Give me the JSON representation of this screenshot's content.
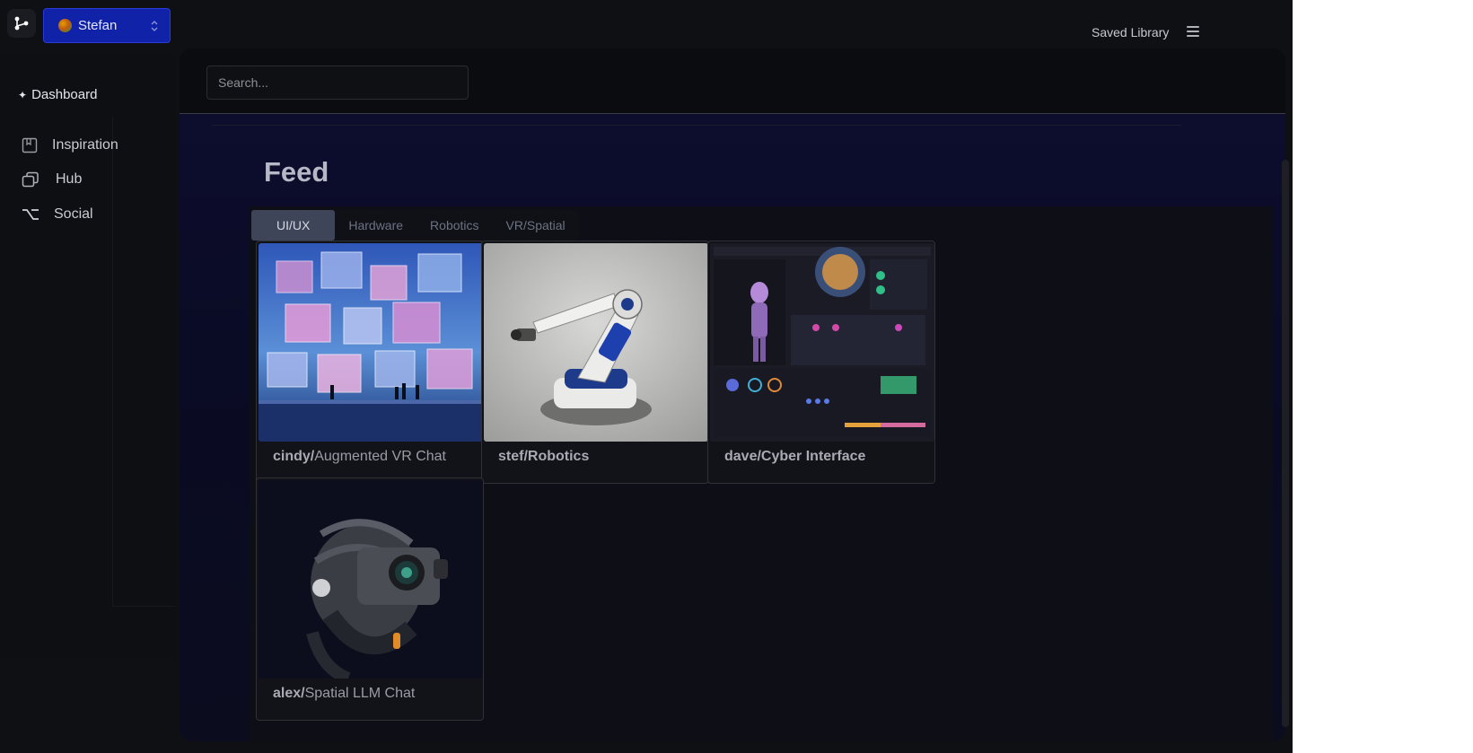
{
  "header": {
    "user_name": "Stefan",
    "saved_library_label": "Saved Library"
  },
  "sidebar": {
    "dashboard_label": "Dashboard",
    "items": [
      {
        "label": "Inspiration",
        "icon": "bookmark-icon"
      },
      {
        "label": "Hub",
        "icon": "stack-icon"
      },
      {
        "label": "Social",
        "icon": "option-key-icon"
      }
    ]
  },
  "search": {
    "placeholder": "Search..."
  },
  "feed": {
    "title": "Feed",
    "tabs": [
      "UI/UX",
      "Hardware",
      "Robotics",
      "VR/Spatial"
    ],
    "active_tab": "UI/UX",
    "cards": [
      {
        "user": "cindy/",
        "title": "Augmented VR Chat",
        "image": "glass-cubes-city-scene"
      },
      {
        "user": "stef/",
        "title": "Robotics",
        "image": "industrial-robot-arm"
      },
      {
        "user": "dave/",
        "title": "Cyber Interface",
        "image": "dark-dashboard-ui"
      },
      {
        "user": "alex/",
        "title": "Spatial LLM Chat",
        "image": "vr-headset-helmet"
      }
    ]
  },
  "colors": {
    "accent": "#1022a8",
    "background": "#0f1014",
    "active_tab": "#3f4559"
  }
}
